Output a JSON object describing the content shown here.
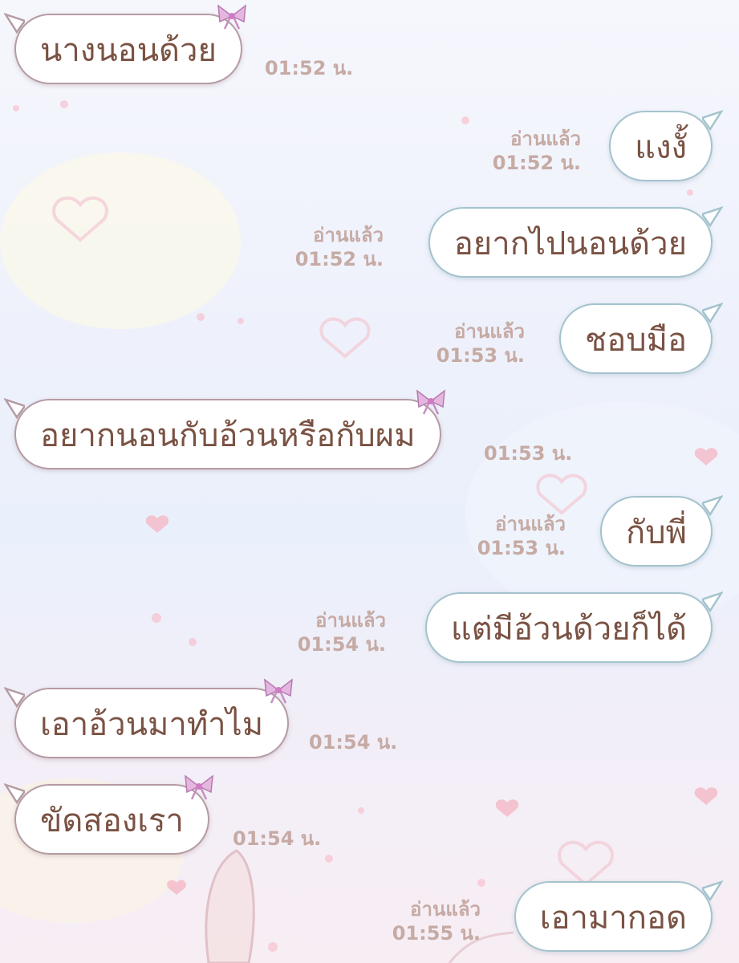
{
  "chat": {
    "messages": [
      {
        "side": "in",
        "text": "นางนอนด้วย",
        "time": "01:52 น.",
        "read": ""
      },
      {
        "side": "out",
        "text": "แงงั้",
        "time": "01:52 น.",
        "read": "อ่านแล้ว"
      },
      {
        "side": "out",
        "text": "อยากไปนอนด้วย",
        "time": "01:52 น.",
        "read": "อ่านแล้ว"
      },
      {
        "side": "out",
        "text": "ชอบมือ",
        "time": "01:53 น.",
        "read": "อ่านแล้ว"
      },
      {
        "side": "in",
        "text": "อยากนอนกับอ้วนหรือกับผม",
        "time": "01:53 น.",
        "read": ""
      },
      {
        "side": "out",
        "text": "กับพี่",
        "time": "01:53 น.",
        "read": "อ่านแล้ว"
      },
      {
        "side": "out",
        "text": "แต่มีอ้วนด้วยก็ได้",
        "time": "01:54 น.",
        "read": "อ่านแล้ว"
      },
      {
        "side": "in",
        "text": "เอาอ้วนมาทำไม",
        "time": "01:54 น.",
        "read": ""
      },
      {
        "side": "in",
        "text": "ขัดสองเรา",
        "time": "01:54 น.",
        "read": ""
      },
      {
        "side": "out",
        "text": "เอามากอด",
        "time": "01:55 น.",
        "read": "อ่านแล้ว"
      }
    ]
  },
  "theme": {
    "text_color": "#7a5243",
    "meta_color": "#c6aaa4",
    "incoming_border": "#b59ba3",
    "outgoing_border": "#a4c3cd",
    "bubble_fill": "#ffffff",
    "bow_color": "#d9a6d4"
  }
}
